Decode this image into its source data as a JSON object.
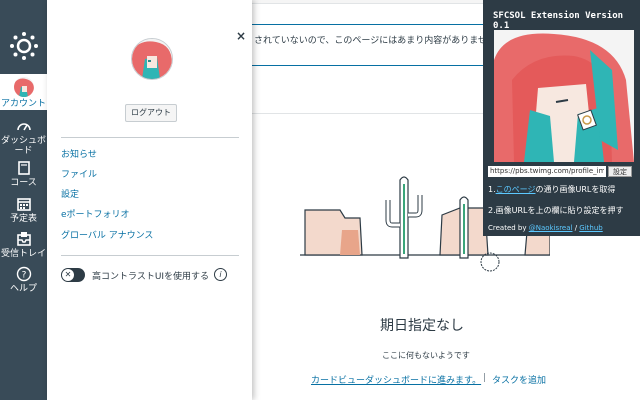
{
  "nav": {
    "items": [
      {
        "label": "アカウント",
        "icon": "avatar"
      },
      {
        "label": "ダッシュボード",
        "icon": "dashboard-icon"
      },
      {
        "label": "コース",
        "icon": "book-icon"
      },
      {
        "label": "予定表",
        "icon": "calendar-icon"
      },
      {
        "label": "受信トレイ",
        "icon": "inbox-icon"
      },
      {
        "label": "ヘルプ",
        "icon": "help-icon"
      }
    ],
    "active_color": "#0770a3",
    "background": "#394b58"
  },
  "tray": {
    "close": "×",
    "logout_label": "ログアウト",
    "links": [
      "お知らせ",
      "ファイル",
      "設定",
      "eポートフォリオ",
      "グローバル アナウンス"
    ],
    "toggle_label": "高コントラストUIを使用する",
    "toggle_state": "off",
    "info": "i"
  },
  "main": {
    "banner_text": "されていないので、このページにはあまり内容がありませ",
    "empty_title": "期日指定なし",
    "empty_sub": "ここに何もないようです",
    "cta_link": "カードビューダッシュボードに進みます。",
    "cta_sep": "|",
    "cta_add": "タスクを追加"
  },
  "extension": {
    "title": "SFCSOL Extension Version 0.1",
    "input_value": "https://pbs.twimg.com/profile_ima",
    "set_button": "設定",
    "step1_prefix": "1.",
    "step1_link": "このページ",
    "step1_suffix": "の通り画像URLを取得",
    "step2": "2.画像URLを上の欄に貼り設定を押す",
    "credit_prefix": "Created by ",
    "credit_author": "@Naokisreal",
    "credit_sep": " / ",
    "credit_github": "Github"
  }
}
